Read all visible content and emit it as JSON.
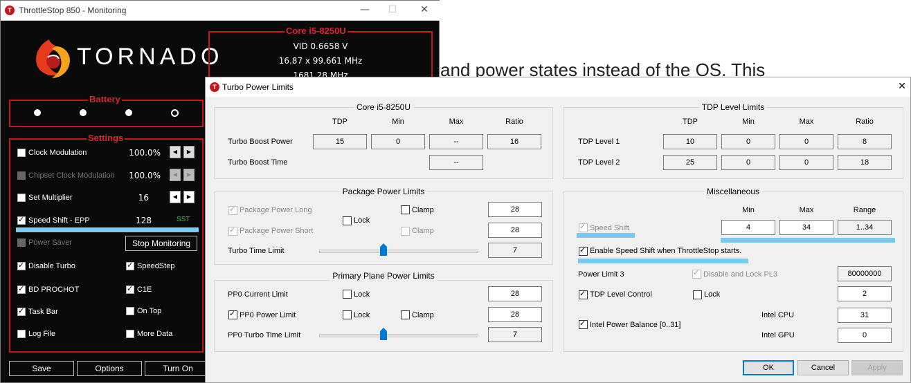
{
  "background": {
    "text": "and power states instead of the OS. This"
  },
  "throttlestop": {
    "title": "ThrottleStop 850 - Monitoring",
    "app_icon_letter": "T",
    "logo_text": "TORNADO",
    "core_box": {
      "title": "Core i5-8250U",
      "vid": "VID  0.6658 V",
      "mhz_line": "16.87 x 99.661 MHz",
      "mhz": "1681.28 MHz"
    },
    "battery_label": "Battery",
    "settings_label": "Settings",
    "rows": [
      {
        "label": "Clock Modulation",
        "value": "100.0%",
        "checked": false,
        "dim": false
      },
      {
        "label": "Chipset Clock Modulation",
        "value": "100.0%",
        "checked": false,
        "dim": true
      },
      {
        "label": "Set Multiplier",
        "value": "16",
        "checked": false,
        "dim": false
      },
      {
        "label": "Speed Shift - EPP",
        "value": "128",
        "checked": true,
        "dim": false,
        "badge": "SST"
      },
      {
        "label": "Power Saver",
        "checked": false,
        "dim": true
      }
    ],
    "stop_button": "Stop Monitoring",
    "left_checks": [
      {
        "label": "Disable Turbo",
        "checked": true
      },
      {
        "label": "BD PROCHOT",
        "checked": true
      },
      {
        "label": "Task Bar",
        "checked": true
      },
      {
        "label": "Log File",
        "checked": false
      }
    ],
    "right_checks": [
      {
        "label": "SpeedStep",
        "checked": true
      },
      {
        "label": "C1E",
        "checked": true
      },
      {
        "label": "On Top",
        "checked": false
      },
      {
        "label": "More Data",
        "checked": false
      }
    ],
    "buttons": {
      "save": "Save",
      "options": "Options",
      "turn_on": "Turn On"
    }
  },
  "dialog": {
    "title": "Turbo Power Limits",
    "close": "✕",
    "core_group": {
      "title": "Core i5-8250U",
      "headers": [
        "TDP",
        "Min",
        "Max",
        "Ratio"
      ],
      "turbo_boost_power": {
        "label": "Turbo Boost Power",
        "values": [
          "15",
          "0",
          "--",
          "16"
        ]
      },
      "turbo_boost_time": {
        "label": "Turbo Boost Time",
        "value": "--"
      }
    },
    "tdp_group": {
      "title": "TDP Level Limits",
      "headers": [
        "TDP",
        "Min",
        "Max",
        "Ratio"
      ],
      "level1": {
        "label": "TDP Level 1",
        "values": [
          "10",
          "0",
          "0",
          "8"
        ]
      },
      "level2": {
        "label": "TDP Level 2",
        "values": [
          "25",
          "0",
          "0",
          "18"
        ]
      }
    },
    "package_group": {
      "title": "Package Power Limits",
      "long": {
        "label": "Package Power Long",
        "value": "28"
      },
      "short": {
        "label": "Package Power Short",
        "value": "28"
      },
      "clamp1": "Clamp",
      "clamp2": "Clamp",
      "lock": "Lock",
      "turbo_time_limit": {
        "label": "Turbo Time Limit",
        "value": "7"
      }
    },
    "misc_group": {
      "title": "Miscellaneous",
      "headers": [
        "Min",
        "Max",
        "Range"
      ],
      "speed_shift": {
        "label": "Speed Shift",
        "values": [
          "4",
          "34",
          "1..34"
        ]
      },
      "enable_speed_shift": "Enable Speed Shift when ThrottleStop starts.",
      "power_limit_3": {
        "label": "Power Limit 3",
        "check_label": "Disable and Lock PL3",
        "value": "80000000"
      },
      "tdp_level_control": {
        "label": "TDP Level Control",
        "lock": "Lock",
        "value": "2"
      },
      "intel_power_balance": {
        "label": "Intel Power Balance  [0..31]",
        "cpu_label": "Intel CPU",
        "cpu_value": "31",
        "gpu_label": "Intel GPU",
        "gpu_value": "0"
      }
    },
    "pp0_group": {
      "title": "Primary Plane Power Limits",
      "current": {
        "label": "PP0 Current Limit",
        "lock": "Lock",
        "value": "28"
      },
      "power": {
        "label": "PP0 Power Limit",
        "lock": "Lock",
        "clamp": "Clamp",
        "value": "28"
      },
      "turbo_time": {
        "label": "PP0 Turbo Time Limit",
        "value": "7"
      }
    },
    "buttons": {
      "ok": "OK",
      "cancel": "Cancel",
      "apply": "Apply"
    }
  }
}
